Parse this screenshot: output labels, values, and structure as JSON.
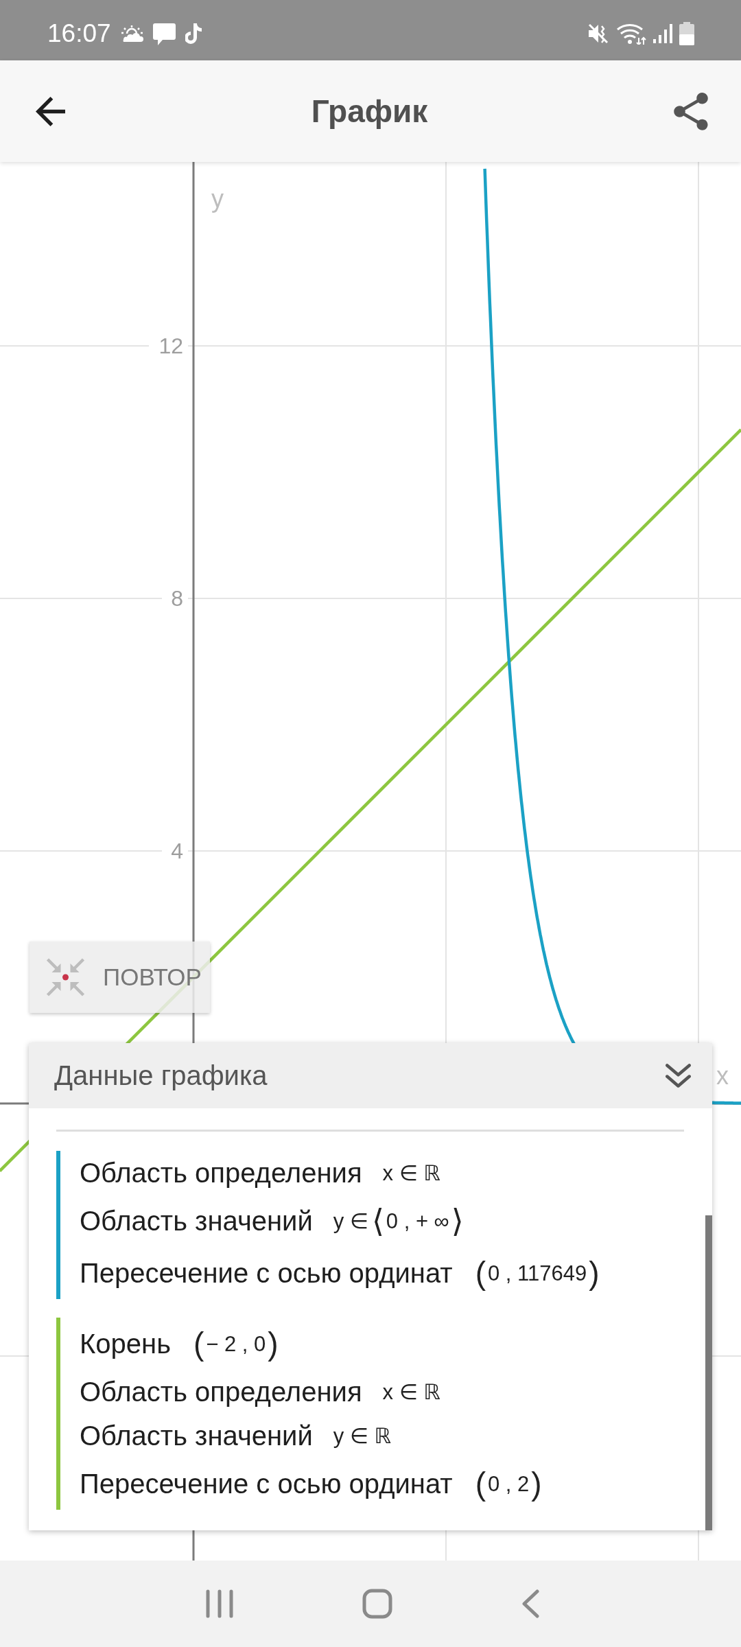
{
  "status_bar": {
    "time": "16:07"
  },
  "app_bar": {
    "title": "График"
  },
  "graph": {
    "y_axis_label": "y",
    "x_axis_label": "x",
    "y_tick_labels": [
      "12",
      "8",
      "4"
    ]
  },
  "reset_button": {
    "label": "ПОВТОР"
  },
  "data_panel": {
    "title": "Данные графика",
    "groups": [
      {
        "color": "#1ba1c5",
        "rows": [
          {
            "label": "Область определения",
            "prefix": "x ∈ ℝ"
          },
          {
            "label": "Область значений",
            "prefix": "y ∈",
            "open": "⟨",
            "inner": "0 , + ∞",
            "close": "⟩"
          },
          {
            "label": "Пересечение с осью ординат",
            "open": "(",
            "inner": "0 , 117649",
            "close": ")"
          }
        ]
      },
      {
        "color": "#8dc63f",
        "rows": [
          {
            "label": "Корень",
            "open": "(",
            "inner": "− 2 , 0",
            "close": ")"
          },
          {
            "label": "Область определения",
            "prefix": "x ∈ ℝ"
          },
          {
            "label": "Область значений",
            "prefix": "y ∈ ℝ"
          },
          {
            "label": "Пересечение с осью ординат",
            "open": "(",
            "inner": "0 , 2",
            "close": ")"
          }
        ]
      }
    ]
  }
}
